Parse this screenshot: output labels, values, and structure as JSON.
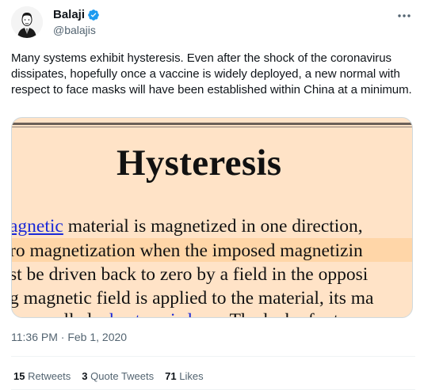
{
  "author": {
    "display_name": "Balaji",
    "handle": "@balajis",
    "verified_color": "#1d9bf0"
  },
  "tweet": {
    "text": "Many systems exhibit hysteresis. Even after the shock of the coronavirus dissipates, hopefully once a vaccine is widely deployed, a new normal with respect to face masks will have been established within China at a minimum.",
    "timestamp": "11:36 PM · Feb 1, 2020"
  },
  "media": {
    "heading": "Hysteresis",
    "line1_link": "agnetic",
    "line1_rest": " material is magnetized in one direction,",
    "line2": "ro magnetization when the imposed magnetizin",
    "line3": "st be driven back to zero by a field in the opposi",
    "line4": "g magnetic field is applied to the material, its ma",
    "line5_start": "loop called a ",
    "line5_link": "hysteresis loop",
    "line5_end": ". The lack of retrac",
    "background_color": "#ffe3c7"
  },
  "stats": {
    "retweets_count": "15",
    "retweets_label": "Retweets",
    "quotes_count": "3",
    "quotes_label": "Quote Tweets",
    "likes_count": "71",
    "likes_label": "Likes"
  },
  "icons": {
    "more": "more-dots-icon",
    "verified": "verified-badge-icon"
  }
}
